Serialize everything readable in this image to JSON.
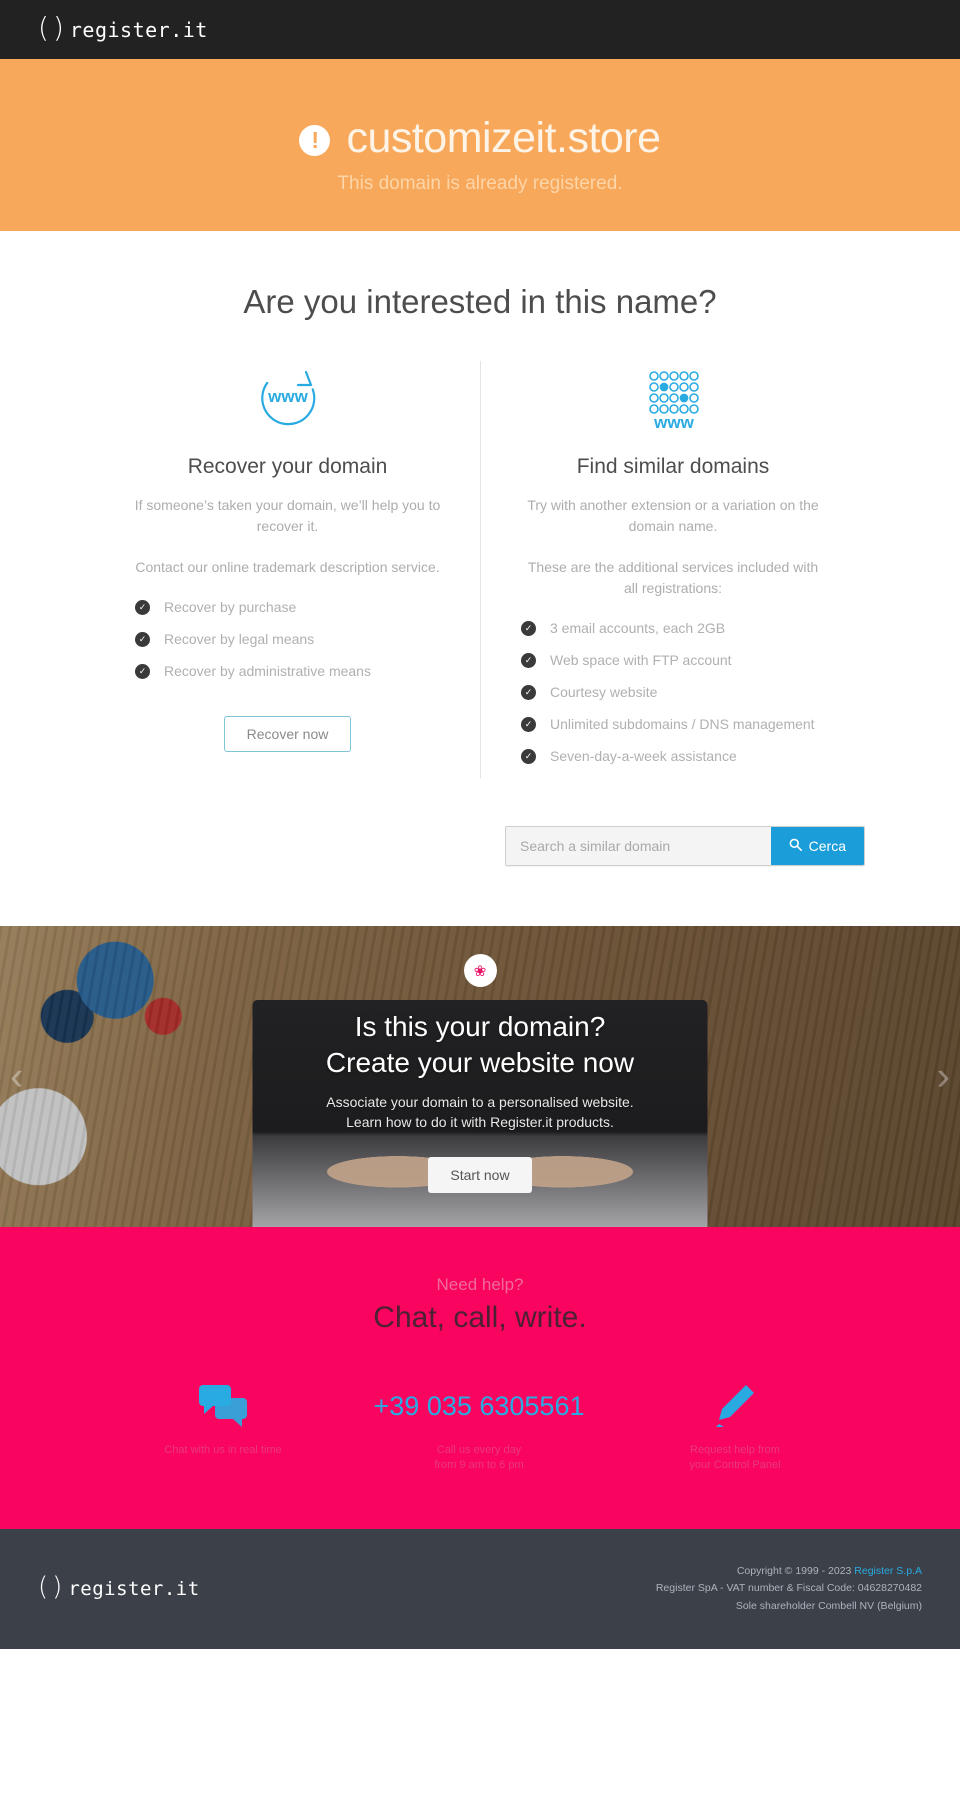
{
  "brand": {
    "logo_paren_left": "(",
    "logo_paren_right": ")",
    "logo_word": "register.it"
  },
  "hero": {
    "icon": "exclamation-circle-icon",
    "icon_glyph": "!",
    "domain": "customizeit.store",
    "subtitle": "This domain is already registered.",
    "bg_color": "#f8a85a"
  },
  "main": {
    "heading": "Are you interested in this name?",
    "columns": [
      {
        "icon": "www-refresh-icon",
        "icon_label": "www",
        "title": "Recover your domain",
        "paragraphs": [
          "If someone’s taken your domain, we’ll help you to recover it.",
          "Contact our online trademark description service."
        ],
        "features": [
          "Recover by purchase",
          "Recover by legal means",
          "Recover by administrative means"
        ],
        "button": "Recover now"
      },
      {
        "icon": "www-dots-icon",
        "icon_label": "www",
        "title": "Find similar domains",
        "paragraphs": [
          "Try with another extension or a variation on the domain name.",
          "These are the additional services included with all registrations:"
        ],
        "features": [
          "3 email accounts, each 2GB",
          "Web space with FTP account",
          "Courtesy website",
          "Unlimited subdomains / DNS management",
          "Seven-day-a-week assistance"
        ],
        "button": null
      }
    ]
  },
  "search": {
    "placeholder": "Search a similar domain",
    "value": "",
    "button_label": "Cerca",
    "button_icon": "search-icon",
    "button_color": "#1b9dd9"
  },
  "banner": {
    "badge_icon": "palette-icon",
    "badge_glyph": "❀",
    "heading_line1": "Is this your domain?",
    "heading_line2": "Create your website now",
    "paragraph_line1": "Associate your domain to a personalised website.",
    "paragraph_line2": "Learn how to do it with Register.it products.",
    "button_label": "Start now",
    "prev_icon": "chevron-left-icon",
    "next_icon": "chevron-right-icon"
  },
  "help": {
    "kicker": "Need help?",
    "heading": "Chat, call, write.",
    "bg_color": "#f9045f",
    "items": [
      {
        "icon": "chat-bubbles-icon",
        "value": null,
        "note_line1": "Chat with us in real time",
        "note_line2": ""
      },
      {
        "icon": "phone-number",
        "value": "+39 035 6305561",
        "note_line1": "Call us every day",
        "note_line2": "from 9 am to 6 pm"
      },
      {
        "icon": "pencil-icon",
        "value": null,
        "note_line1": "Request help from",
        "note_line2": "your Control Panel"
      }
    ]
  },
  "footer": {
    "copyright_prefix": "Copyright © 1999 - 2023 ",
    "copyright_link": "Register S.p.A",
    "line2": "Register SpA - VAT number & Fiscal Code: 04628270482",
    "line3": "Sole shareholder Combell NV (Belgium)"
  }
}
